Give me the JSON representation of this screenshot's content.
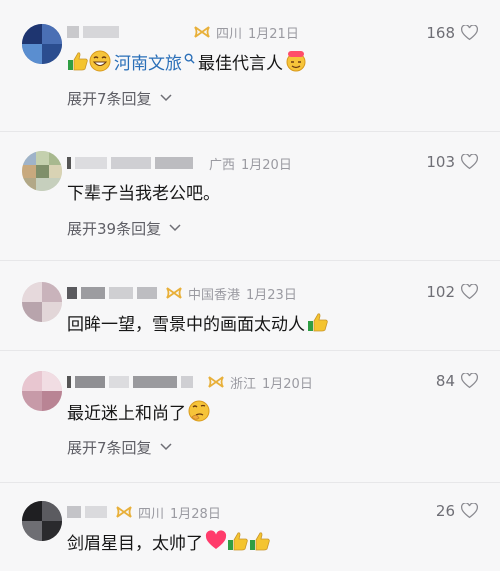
{
  "comments": [
    {
      "location": "四川",
      "date": "1月21日",
      "likes": "168",
      "text_pre": "",
      "link": "河南文旅",
      "text_post": "最佳代言人",
      "expand": "展开7条回复"
    },
    {
      "location": "广西",
      "date": "1月20日",
      "likes": "103",
      "text": "下辈子当我老公吧。",
      "expand": "展开39条回复"
    },
    {
      "location": "中国香港",
      "date": "1月23日",
      "likes": "102",
      "text": "回眸一望，雪景中的画面太动人"
    },
    {
      "location": "浙江",
      "date": "1月20日",
      "likes": "84",
      "text": "最近迷上和尚了",
      "expand": "展开7条回复"
    },
    {
      "location": "四川",
      "date": "1月28日",
      "likes": "26",
      "text": "剑眉星目，太帅了"
    }
  ],
  "icons": {
    "like": "heart-outline-icon",
    "expand": "chevron-down-icon",
    "badge": "fan-badge-icon",
    "search_link": "search-link-icon"
  },
  "colors": {
    "link": "#2a6fb8",
    "badge": "#e8b03a",
    "muted": "#9a9aa1",
    "heart": "#ff3b6b"
  }
}
